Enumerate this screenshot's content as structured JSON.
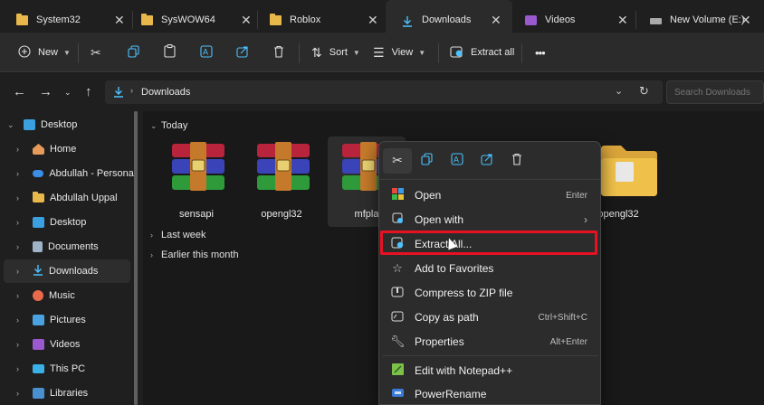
{
  "tabs": [
    {
      "label": "System32",
      "icon": "folder-icon"
    },
    {
      "label": "SysWOW64",
      "icon": "folder-icon"
    },
    {
      "label": "Roblox",
      "icon": "folder-icon"
    },
    {
      "label": "Downloads",
      "icon": "download-icon",
      "active": true
    },
    {
      "label": "Videos",
      "icon": "videos-icon"
    },
    {
      "label": "New Volume (E:)",
      "icon": "drive-icon"
    }
  ],
  "toolbar": {
    "new_label": "New",
    "sort_label": "Sort",
    "view_label": "View",
    "extract_label": "Extract all",
    "more_label": "•••"
  },
  "address": {
    "current": "Downloads",
    "search_placeholder": "Search Downloads"
  },
  "sidebar": {
    "items": [
      {
        "label": "Desktop",
        "icon": "desktop-icon",
        "expanded": true
      },
      {
        "label": "Home",
        "icon": "home-icon"
      },
      {
        "label": "Abdullah - Personal",
        "icon": "onedrive-icon"
      },
      {
        "label": "Abdullah Uppal",
        "icon": "folder-icon"
      },
      {
        "label": "Desktop",
        "icon": "desktop-icon"
      },
      {
        "label": "Documents",
        "icon": "documents-icon"
      },
      {
        "label": "Downloads",
        "icon": "download-icon",
        "selected": true
      },
      {
        "label": "Music",
        "icon": "music-icon"
      },
      {
        "label": "Pictures",
        "icon": "pictures-icon"
      },
      {
        "label": "Videos",
        "icon": "videos-icon"
      },
      {
        "label": "This PC",
        "icon": "pc-icon"
      },
      {
        "label": "Libraries",
        "icon": "libraries-icon"
      }
    ]
  },
  "content": {
    "groups": {
      "today": "Today",
      "last_week": "Last week",
      "earlier": "Earlier this month"
    },
    "files": [
      {
        "name": "sensapi",
        "type": "rar"
      },
      {
        "name": "opengl32",
        "type": "rar"
      },
      {
        "name": "mfpla",
        "type": "rar"
      },
      {
        "name": "opengl32",
        "type": "folder"
      }
    ]
  },
  "context_menu": {
    "quick_actions": [
      "cut-icon",
      "copy-icon",
      "rename-icon",
      "share-icon",
      "delete-icon"
    ],
    "items": [
      {
        "label": "Open",
        "shortcut": "Enter",
        "icon": "open-icon"
      },
      {
        "label": "Open with",
        "shortcut": "",
        "icon": "open-with-icon",
        "submenu": true
      },
      {
        "label": "Extract All...",
        "shortcut": "",
        "icon": "extract-icon",
        "highlighted": true
      },
      {
        "label": "Add to Favorites",
        "shortcut": "",
        "icon": "star-icon"
      },
      {
        "label": "Compress to ZIP file",
        "shortcut": "",
        "icon": "zip-icon"
      },
      {
        "label": "Copy as path",
        "shortcut": "Ctrl+Shift+C",
        "icon": "copy-path-icon"
      },
      {
        "label": "Properties",
        "shortcut": "Alt+Enter",
        "icon": "properties-icon"
      },
      {
        "label": "Edit with Notepad++",
        "shortcut": "",
        "icon": "notepadpp-icon"
      },
      {
        "label": "PowerRename",
        "shortcut": "",
        "icon": "powerrename-icon"
      }
    ]
  },
  "colors": {
    "highlight_border": "#e81123",
    "folder": "#e8b84a",
    "accent": "#4cc2ff"
  }
}
